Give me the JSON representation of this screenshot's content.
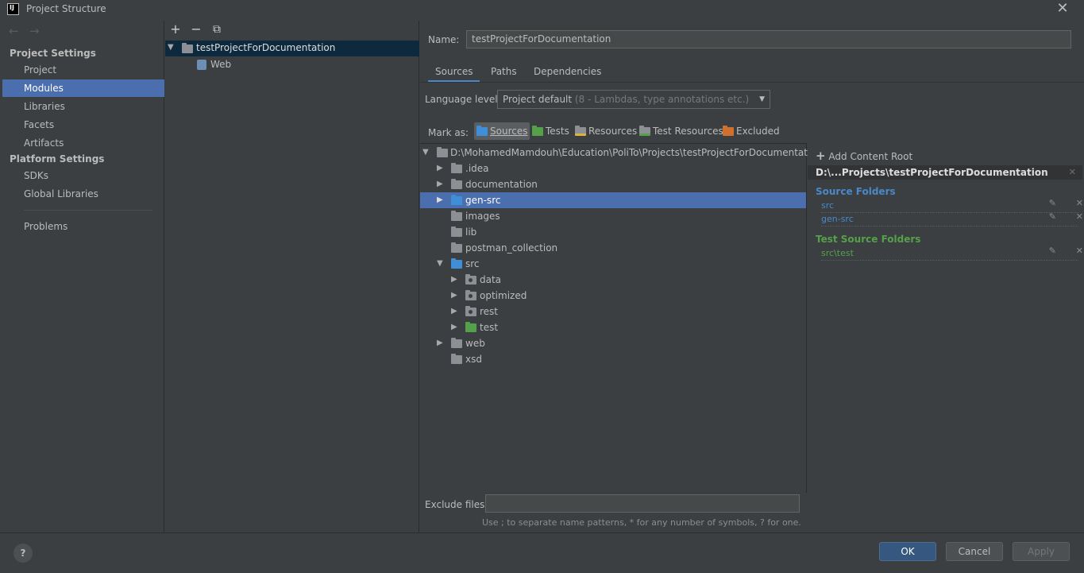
{
  "window": {
    "title": "Project Structure",
    "close_glyph": "✕"
  },
  "nav": {
    "back_glyph": "←",
    "forward_glyph": "→",
    "project_settings_title": "Project Settings",
    "project_settings_items": [
      "Project",
      "Modules",
      "Libraries",
      "Facets",
      "Artifacts"
    ],
    "selected": "Modules",
    "platform_settings_title": "Platform Settings",
    "platform_settings_items": [
      "SDKs",
      "Global Libraries"
    ],
    "problems": "Problems"
  },
  "modules": {
    "toolbar": {
      "add": "+",
      "remove": "−",
      "copy": "⧉"
    },
    "root": "testProjectForDocumentation",
    "children": [
      "Web"
    ]
  },
  "editor": {
    "name_label": "Name:",
    "name_value": "testProjectForDocumentation",
    "tabs": [
      "Sources",
      "Paths",
      "Dependencies"
    ],
    "active_tab": "Sources",
    "language_level_label": "Language level:",
    "language_level_value": "Project default",
    "language_level_detail": "(8 - Lambdas, type annotations etc.)",
    "mark_as_label": "Mark as:",
    "mark_as": {
      "sources": "Sources",
      "tests": "Tests",
      "resources": "Resources",
      "test_resources": "Test Resources",
      "excluded": "Excluded"
    },
    "tree": {
      "root": "D:\\MohamedMamdouh\\Education\\PoliTo\\Projects\\testProjectForDocumentation",
      "items": {
        "idea": ".idea",
        "documentation": "documentation",
        "gen_src": "gen-src",
        "images": "images",
        "lib": "lib",
        "postman": "postman_collection",
        "src": "src",
        "data": "data",
        "optimized": "optimized",
        "rest": "rest",
        "test": "test",
        "web": "web",
        "xsd": "xsd"
      },
      "selected": "gen-src"
    },
    "exclude_files_label": "Exclude files:",
    "exclude_files_value": "",
    "exclude_files_hint": "Use ; to separate name patterns, * for any number of symbols, ? for one."
  },
  "content_roots": {
    "add_label": "Add Content Root",
    "root_path": "D:\\...Projects\\testProjectForDocumentation",
    "source_folders_title": "Source Folders",
    "source_folders": [
      "src",
      "gen-src"
    ],
    "test_source_folders_title": "Test Source Folders",
    "test_source_folders": [
      "src\\test"
    ]
  },
  "buttons": {
    "help": "?",
    "ok": "OK",
    "cancel": "Cancel",
    "apply": "Apply"
  },
  "colors": {
    "accent": "#4b6eaf",
    "source_blue": "#4a88c7",
    "test_green": "#55a04b",
    "excluded_orange": "#d0702e"
  }
}
